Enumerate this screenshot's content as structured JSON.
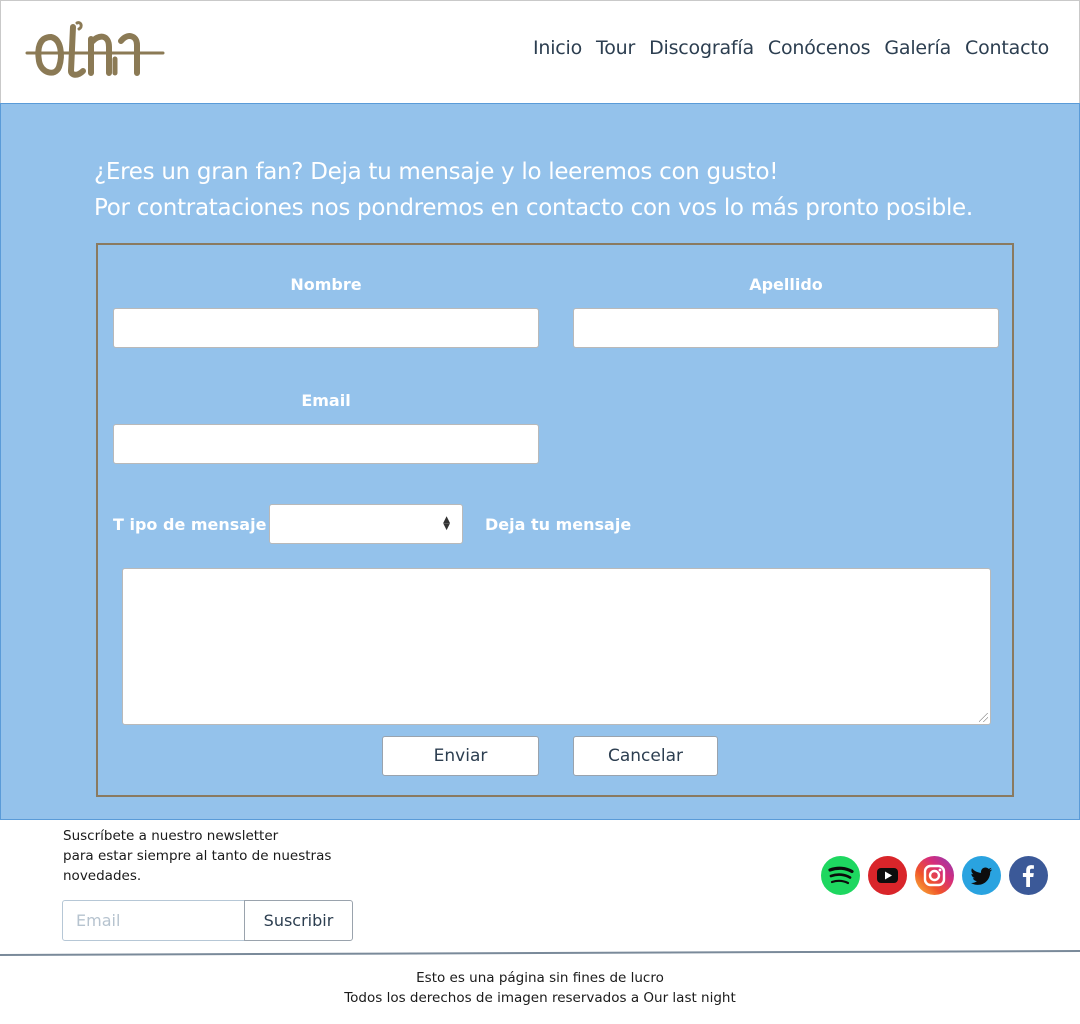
{
  "header": {
    "nav": [
      "Inicio",
      "Tour",
      "Discografía",
      "Conócenos",
      "Galería",
      "Contacto"
    ]
  },
  "intro": {
    "line1": "¿Eres un gran fan? Deja tu mensaje y lo leeremos con gusto!",
    "line2": "Por contrataciones nos pondremos en contacto con vos lo más pronto posible."
  },
  "form": {
    "nombre_label": "Nombre",
    "apellido_label": "Apellido",
    "email_label": "Email",
    "tipo_label": "T ipo de mensaje",
    "mensaje_label": "Deja tu mensaje",
    "enviar": "Enviar",
    "cancelar": "Cancelar"
  },
  "footer": {
    "newsletter_line1": "Suscríbete a nuestro newsletter",
    "newsletter_line2": "para estar siempre al tanto de nuestras",
    "newsletter_line3": "novedades.",
    "email_placeholder": "Email",
    "subscribe": "Suscribir",
    "social": [
      "spotify-icon",
      "youtube-icon",
      "instagram-icon",
      "twitter-icon",
      "facebook-icon"
    ],
    "copy_line1": "Esto es una página  sin fines de lucro",
    "copy_line2": "Todos los derechos de imagen reservados a Our last night"
  },
  "colors": {
    "main_bg": "#94c2eb",
    "form_border": "#8a7a60",
    "logo": "#8b7a55",
    "spotify": "#1ed760",
    "youtube": "#d9252a",
    "twitter": "#2aa3e0",
    "facebook": "#3b5998"
  }
}
